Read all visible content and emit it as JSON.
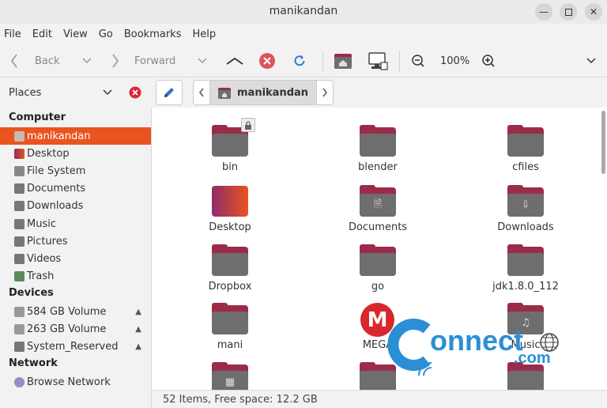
{
  "window": {
    "title": "manikandan"
  },
  "menu": [
    "File",
    "Edit",
    "View",
    "Go",
    "Bookmarks",
    "Help"
  ],
  "toolbar": {
    "back_label": "Back",
    "forward_label": "Forward",
    "zoom_level": "100%"
  },
  "places_header": {
    "label": "Places"
  },
  "path": {
    "current": "manikandan"
  },
  "sidebar": {
    "computer_heading": "Computer",
    "computer": [
      "manikandan",
      "Desktop",
      "File System",
      "Documents",
      "Downloads",
      "Music",
      "Pictures",
      "Videos",
      "Trash"
    ],
    "devices_heading": "Devices",
    "devices": [
      "584 GB Volume",
      "263 GB Volume",
      "System_Reserved"
    ],
    "network_heading": "Network",
    "network": [
      "Browse Network"
    ]
  },
  "items": [
    "bin",
    "blender",
    "cfiles",
    "Desktop",
    "Documents",
    "Downloads",
    "Dropbox",
    "go",
    "jdk1.8.0_112",
    "mani",
    "MEGA",
    "Music"
  ],
  "status": {
    "text": "52 Items, Free space: 12.2 GB"
  },
  "watermark": {
    "text_main": "onnect",
    "text_sub": ".com"
  },
  "colors": {
    "accent": "#e95420",
    "folder_tab": "#9c2b4a",
    "folder_body": "#6e6e6e",
    "watermark_blue": "#2b8fd6"
  }
}
